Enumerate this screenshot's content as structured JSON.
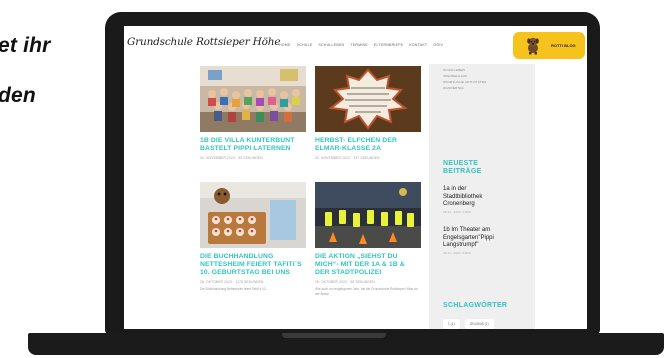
{
  "background": {
    "line1": "et ihr",
    "line2": "den"
  },
  "site": {
    "logo": "Grundschule Rottsieper Höhe",
    "nav": [
      "HOME",
      "SCHULE",
      "SCHULLEBEN",
      "TERMINE",
      "ELTERNBRIEFE",
      "KONTAKT",
      "OGIV"
    ],
    "rotti_label": "ROTTI BLOG",
    "accent_color": "#33c3c3",
    "brand_yellow": "#f6c31c"
  },
  "posts": [
    {
      "title": "1B DIE VILLA KUNTERBUNT BASTELT PIPPI LATERNEN",
      "meta": "02. NOVEMBER 2023 · 20 SEKUNDEN",
      "image": "class-photo",
      "excerpt": ""
    },
    {
      "title": "HERBST- ELFCHEN DER ELMAR-KLASSE 2A",
      "meta": "02. NOVEMBER 2023 · 337 SEKUNDEN",
      "image": "leaf-poem",
      "excerpt": ""
    },
    {
      "title": "DIE BUCHHANDLUNG NETTESHEIM FEIERT TAFITI´S 10. GEBURTSTAG BEI UNS",
      "meta": "28. OKTOBER 2023 · 1178 SEKUNDEN",
      "image": "cupcakes",
      "excerpt": "Die Buchhandlung Nettesheim feiert Tafiti´s 10."
    },
    {
      "title": "DIE AKTION „SIEHST DU MICH“- MIT DER 1A & 1B & DER STADTPOLIZEI",
      "meta": "26. OKTOBER 2023 · 59 SEKUNDEN",
      "image": "safety-vests",
      "excerpt": "Wie auch im vergangenen Jahr, hat die Grundschule Rottsieper Höhe an der Aktion"
    }
  ],
  "sidebar": {
    "categories": [
      "SCHULLEBEN",
      "SPENDENLAUF",
      "SPORTLICHE AKTIVITÄTEN",
      "WANDERTAG"
    ],
    "recent_heading_1": "NEUESTE",
    "recent_heading_2": "BEITRÄGE",
    "recent": [
      {
        "title_1": "1a in der",
        "title_2": "Stadtbibliothek",
        "title_3": "Cronenberg",
        "date": "08.11. 2023·3 MIN"
      },
      {
        "title_1": "1b Im Theater am",
        "title_2": "Engelsgarten\"Pippi",
        "title_3": "Langstrumpf\"",
        "date": "08.11. 2023·3 MIN"
      }
    ],
    "tags_heading": "SCHLAGWÖRTER",
    "tags": [
      "1 (1)",
      "ZEUGNIS (1)"
    ]
  }
}
